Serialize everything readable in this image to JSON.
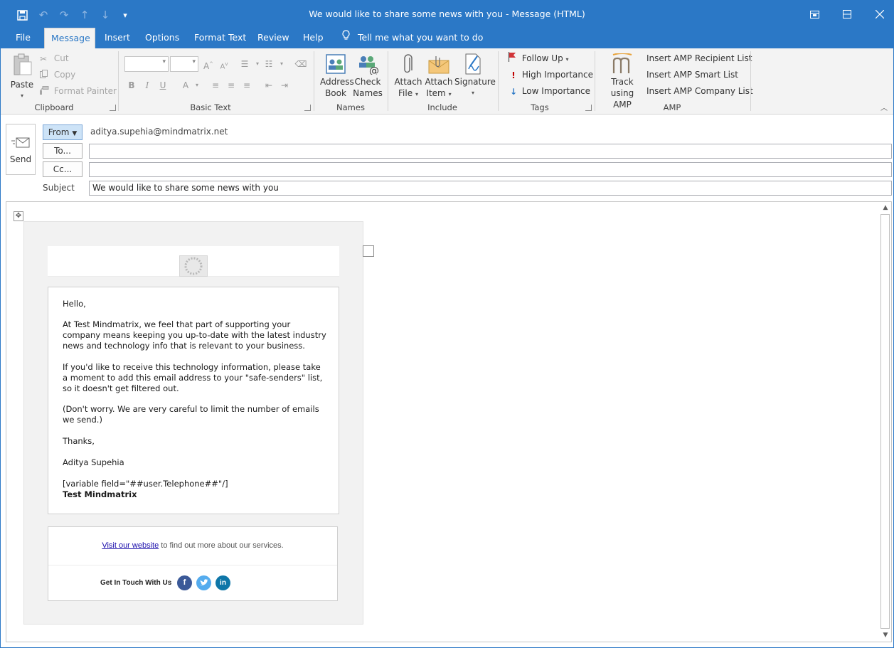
{
  "window": {
    "title": "We would like to share some news with you  -  Message (HTML)"
  },
  "quick_access": {
    "icons": [
      "save-icon",
      "undo-icon",
      "redo-icon",
      "previous-item-icon",
      "next-item-icon",
      "customize-toolbar-icon"
    ]
  },
  "tabs": [
    {
      "label": "File"
    },
    {
      "label": "Message"
    },
    {
      "label": "Insert"
    },
    {
      "label": "Options"
    },
    {
      "label": "Format Text"
    },
    {
      "label": "Review"
    },
    {
      "label": "Help"
    }
  ],
  "tell_me": "Tell me what you want to do",
  "ribbon": {
    "clipboard": {
      "label": "Clipboard",
      "paste": "Paste",
      "cut": "Cut",
      "copy": "Copy",
      "format_painter": "Format Painter"
    },
    "basic_text": {
      "label": "Basic Text"
    },
    "names": {
      "label": "Names",
      "address_book_1": "Address",
      "address_book_2": "Book",
      "check_names_1": "Check",
      "check_names_2": "Names"
    },
    "include": {
      "label": "Include",
      "attach_file_1": "Attach",
      "attach_file_2": "File",
      "attach_item_1": "Attach",
      "attach_item_2": "Item",
      "signature": "Signature"
    },
    "tags": {
      "label": "Tags",
      "follow_up": "Follow Up",
      "high_importance": "High Importance",
      "low_importance": "Low Importance"
    },
    "amp": {
      "label": "AMP",
      "track_1": "Track",
      "track_2": "using AMP",
      "recipient_list": "Insert AMP Recipient List",
      "smart_list": "Insert AMP Smart List",
      "company_list": "Insert AMP Company List"
    }
  },
  "header": {
    "send": "Send",
    "from_button": "From",
    "from_value": "aditya.supehia@mindmatrix.net",
    "to_button": "To...",
    "to_value": "",
    "cc_button": "Cc...",
    "cc_value": "",
    "subject_label": "Subject",
    "subject_value": "We would like to share some news with you"
  },
  "email_body": {
    "greeting": "Hello,",
    "para1": "At Test Mindmatrix, we feel that part of supporting your company means keeping you up-to-date with the latest industry news and technology info that is relevant to your business.",
    "para2": "If you'd like to receive this technology information, please take a moment to add this email address to your \"safe-senders\" list, so it doesn't get filtered out.",
    "para3": "(Don't worry. We are very careful to limit the number of emails we send.)",
    "thanks": "Thanks,",
    "sender_name": "Aditya Supehia",
    "variable": "[variable field=\"##user.Telephone##\"/]",
    "company": "Test Mindmatrix"
  },
  "footer": {
    "visit_link": "Visit our website",
    "visit_rest": " to find out more about our services.",
    "get_in_touch": "Get In Touch With Us",
    "social": [
      {
        "icon": "facebook-icon",
        "glyph": "f",
        "color": "#3b5998"
      },
      {
        "icon": "twitter-icon",
        "glyph": "t",
        "color": "#55acee"
      },
      {
        "icon": "linkedin-icon",
        "glyph": "in",
        "color": "#0e76a8"
      }
    ]
  },
  "colors": {
    "accent": "#2b78c6",
    "ribbon_bg": "#f3f3f3",
    "importance_high": "#c00000",
    "importance_low": "#2b78c6",
    "follow_up_flag": "#d13438"
  }
}
